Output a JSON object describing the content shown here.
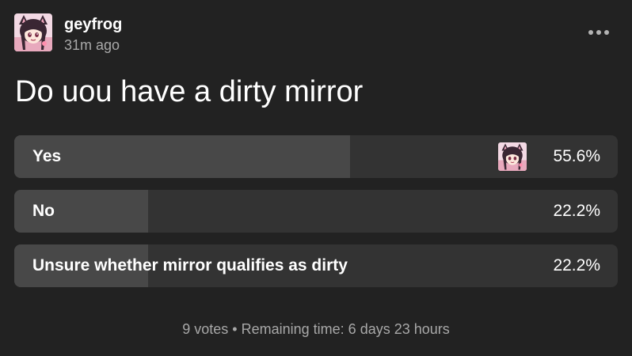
{
  "post": {
    "author": "geyfrog",
    "time_ago": "31m ago",
    "avatar_icon": "anime-avatar-icon",
    "more_icon": "more-options-icon"
  },
  "poll": {
    "question": "Do uou have a dirty mirror",
    "options": [
      {
        "label": "Yes",
        "percent_text": "55.6%",
        "share": 0.556,
        "voted_by_user": true
      },
      {
        "label": "No",
        "percent_text": "22.2%",
        "share": 0.222,
        "voted_by_user": false
      },
      {
        "label": "Unsure whether mirror qualifies as dirty",
        "percent_text": "22.2%",
        "share": 0.222,
        "voted_by_user": false
      }
    ],
    "votes_text": "9 votes",
    "separator": "•",
    "remaining_text": "Remaining time: 6 days 23 hours"
  },
  "colors": {
    "background": "#222222",
    "option_track": "#333333",
    "option_fill": "#484848",
    "muted_text": "#a8a8a8"
  }
}
